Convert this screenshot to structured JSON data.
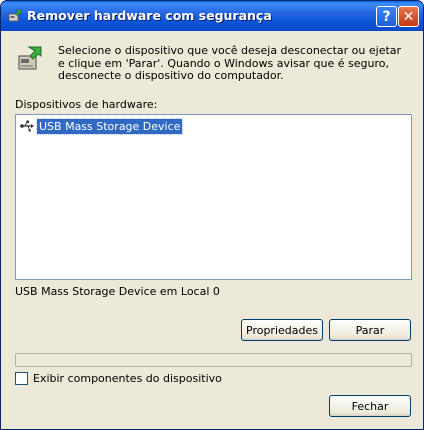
{
  "window": {
    "title": "Remover hardware com segurança",
    "help_label": "?",
    "close_label": "✕"
  },
  "intro_text": "Selecione o dispositivo que você deseja desconectar ou ejetar e clique em 'Parar'. Quando o Windows avisar que é seguro, desconecte o dispositivo do computador.",
  "list": {
    "label": "Dispositivos de hardware:",
    "items": [
      {
        "label": "USB Mass Storage Device",
        "icon": "usb-device-icon",
        "selected": true
      }
    ]
  },
  "status_text": "USB Mass Storage Device em Local 0",
  "buttons": {
    "properties": "Propriedades",
    "stop": "Parar",
    "close": "Fechar"
  },
  "progress": {
    "value": 0
  },
  "checkbox": {
    "label": "Exibir componentes do dispositivo",
    "checked": false
  },
  "colors": {
    "titlebar": "#0b55d6",
    "selection": "#316ac5"
  }
}
